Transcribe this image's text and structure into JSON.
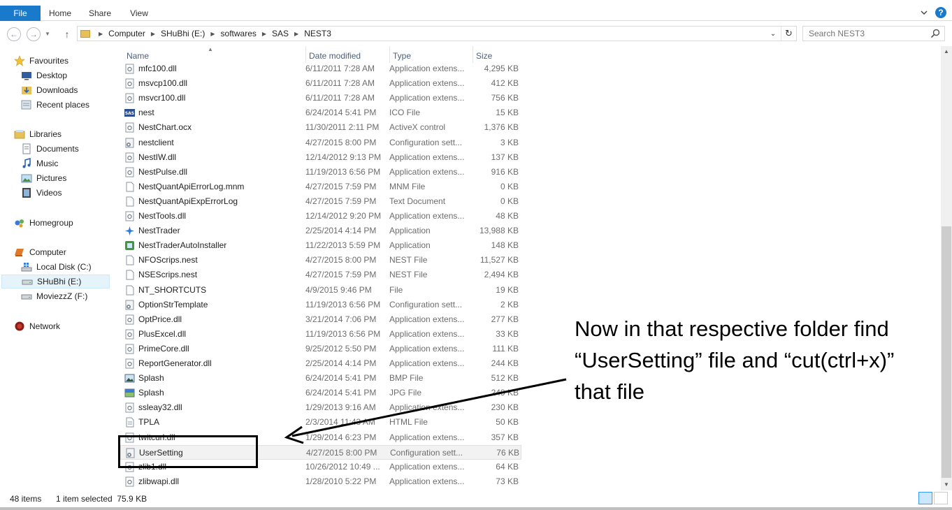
{
  "ribbon": {
    "tabs": [
      "File",
      "Home",
      "Share",
      "View"
    ],
    "help": "?"
  },
  "address_bar": {
    "crumbs": [
      "Computer",
      "SHuBhi (E:)",
      "softwares",
      "SAS",
      "NEST3"
    ]
  },
  "search": {
    "placeholder": "Search NEST3"
  },
  "navigation": {
    "favourites": {
      "label": "Favourites",
      "items": [
        "Desktop",
        "Downloads",
        "Recent places"
      ]
    },
    "libraries": {
      "label": "Libraries",
      "items": [
        "Documents",
        "Music",
        "Pictures",
        "Videos"
      ]
    },
    "homegroup": "Homegroup",
    "computer": {
      "label": "Computer",
      "items": [
        "Local Disk (C:)",
        "SHuBhi (E:)",
        "MoviezzZ (F:)"
      ]
    },
    "network": "Network"
  },
  "columns": {
    "name": "Name",
    "date": "Date modified",
    "type": "Type",
    "size": "Size"
  },
  "files": [
    {
      "name": "mfc100.dll",
      "date": "6/11/2011 7:28 AM",
      "type": "Application extens...",
      "size": "4,295 KB",
      "icon": "dll"
    },
    {
      "name": "msvcp100.dll",
      "date": "6/11/2011 7:28 AM",
      "type": "Application extens...",
      "size": "412 KB",
      "icon": "dll"
    },
    {
      "name": "msvcr100.dll",
      "date": "6/11/2011 7:28 AM",
      "type": "Application extens...",
      "size": "756 KB",
      "icon": "dll"
    },
    {
      "name": "nest",
      "date": "6/24/2014 5:41 PM",
      "type": "ICO File",
      "size": "15 KB",
      "icon": "sas"
    },
    {
      "name": "NestChart.ocx",
      "date": "11/30/2011 2:11 PM",
      "type": "ActiveX control",
      "size": "1,376 KB",
      "icon": "dll"
    },
    {
      "name": "nestclient",
      "date": "4/27/2015 8:00 PM",
      "type": "Configuration sett...",
      "size": "3 KB",
      "icon": "config"
    },
    {
      "name": "NestIW.dll",
      "date": "12/14/2012 9:13 PM",
      "type": "Application extens...",
      "size": "137 KB",
      "icon": "dll"
    },
    {
      "name": "NestPulse.dll",
      "date": "11/19/2013 6:56 PM",
      "type": "Application extens...",
      "size": "916 KB",
      "icon": "dll"
    },
    {
      "name": "NestQuantApiErrorLog.mnm",
      "date": "4/27/2015 7:59 PM",
      "type": "MNM File",
      "size": "0 KB",
      "icon": "blank"
    },
    {
      "name": "NestQuantApiExpErrorLog",
      "date": "4/27/2015 7:59 PM",
      "type": "Text Document",
      "size": "0 KB",
      "icon": "blank"
    },
    {
      "name": "NestTools.dll",
      "date": "12/14/2012 9:20 PM",
      "type": "Application extens...",
      "size": "48 KB",
      "icon": "dll"
    },
    {
      "name": "NestTrader",
      "date": "2/25/2014 4:14 PM",
      "type": "Application",
      "size": "13,988 KB",
      "icon": "app-blue"
    },
    {
      "name": "NestTraderAutoInstaller",
      "date": "11/22/2013 5:59 PM",
      "type": "Application",
      "size": "148 KB",
      "icon": "app-green"
    },
    {
      "name": "NFOScrips.nest",
      "date": "4/27/2015 8:00 PM",
      "type": "NEST File",
      "size": "11,527 KB",
      "icon": "blank"
    },
    {
      "name": "NSEScrips.nest",
      "date": "4/27/2015 7:59 PM",
      "type": "NEST File",
      "size": "2,494 KB",
      "icon": "blank"
    },
    {
      "name": "NT_SHORTCUTS",
      "date": "4/9/2015 9:46 PM",
      "type": "File",
      "size": "19 KB",
      "icon": "blank"
    },
    {
      "name": "OptionStrTemplate",
      "date": "11/19/2013 6:56 PM",
      "type": "Configuration sett...",
      "size": "2 KB",
      "icon": "config"
    },
    {
      "name": "OptPrice.dll",
      "date": "3/21/2014 7:06 PM",
      "type": "Application extens...",
      "size": "277 KB",
      "icon": "dll"
    },
    {
      "name": "PlusExcel.dll",
      "date": "11/19/2013 6:56 PM",
      "type": "Application extens...",
      "size": "33 KB",
      "icon": "dll"
    },
    {
      "name": "PrimeCore.dll",
      "date": "9/25/2012 5:50 PM",
      "type": "Application extens...",
      "size": "111 KB",
      "icon": "dll"
    },
    {
      "name": "ReportGenerator.dll",
      "date": "2/25/2014 4:14 PM",
      "type": "Application extens...",
      "size": "244 KB",
      "icon": "dll"
    },
    {
      "name": "Splash",
      "date": "6/24/2014 5:41 PM",
      "type": "BMP File",
      "size": "512 KB",
      "icon": "image"
    },
    {
      "name": "Splash",
      "date": "6/24/2014 5:41 PM",
      "type": "JPG File",
      "size": "249 KB",
      "icon": "image-color"
    },
    {
      "name": "ssleay32.dll",
      "date": "1/29/2013 9:16 AM",
      "type": "Application extens...",
      "size": "230 KB",
      "icon": "dll"
    },
    {
      "name": "TPLA",
      "date": "2/3/2014 11:43 AM",
      "type": "HTML File",
      "size": "50 KB",
      "icon": "doc"
    },
    {
      "name": "twitcurl.dll",
      "date": "1/29/2014 6:23 PM",
      "type": "Application extens...",
      "size": "357 KB",
      "icon": "dll"
    },
    {
      "name": "UserSetting",
      "date": "4/27/2015 8:00 PM",
      "type": "Configuration sett...",
      "size": "76 KB",
      "icon": "config",
      "selected": true
    },
    {
      "name": "zlib1.dll",
      "date": "10/26/2012 10:49 ...",
      "type": "Application extens...",
      "size": "64 KB",
      "icon": "dll"
    },
    {
      "name": "zlibwapi.dll",
      "date": "1/28/2010 5:22 PM",
      "type": "Application extens...",
      "size": "73 KB",
      "icon": "dll"
    }
  ],
  "status": {
    "count": "48 items",
    "selection": "1 item selected  75.9 KB"
  },
  "annotation": {
    "lines": [
      "Now in that respective folder find",
      "“UserSetting” file and “cut(ctrl+x)”",
      "that file"
    ]
  },
  "colors": {
    "accent": "#1979ca",
    "header_text": "#4c607a",
    "secondary_text": "#6d6d6d"
  }
}
